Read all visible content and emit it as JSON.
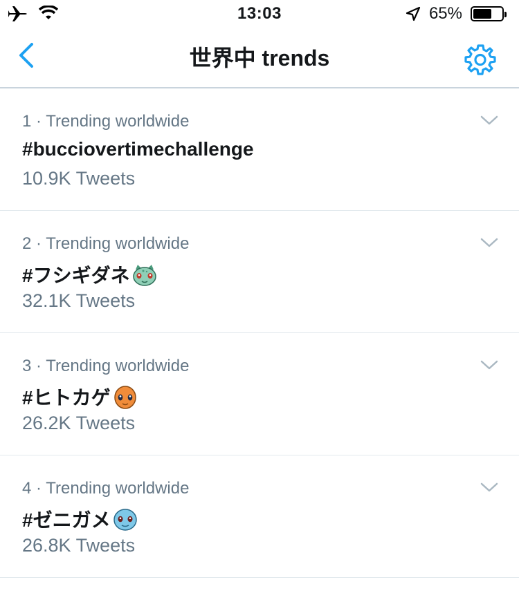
{
  "status_bar": {
    "time": "13:03",
    "battery_percent": "65%",
    "battery_level": 0.65,
    "icons": [
      "airplane-icon",
      "wifi-icon",
      "location-arrow-icon",
      "battery-icon"
    ]
  },
  "nav": {
    "title": "世界中 trends",
    "back_icon": "chevron-left-icon",
    "settings_icon": "gear-icon",
    "accent_color": "#1da1f2"
  },
  "trends": [
    {
      "meta": "1 · Trending worldwide",
      "name": "#bucciovertimechallenge",
      "count": "10.9K Tweets",
      "emoji": ""
    },
    {
      "meta": "2 · Trending worldwide",
      "name": "#フシギダネ",
      "count": "32.1K Tweets",
      "emoji": "bulbasaur-emoji-icon"
    },
    {
      "meta": "3 · Trending worldwide",
      "name": "#ヒトカゲ",
      "count": "26.2K Tweets",
      "emoji": "charmander-emoji-icon"
    },
    {
      "meta": "4 · Trending worldwide",
      "name": "#ゼニガメ",
      "count": "26.8K Tweets",
      "emoji": "squirtle-emoji-icon"
    }
  ]
}
